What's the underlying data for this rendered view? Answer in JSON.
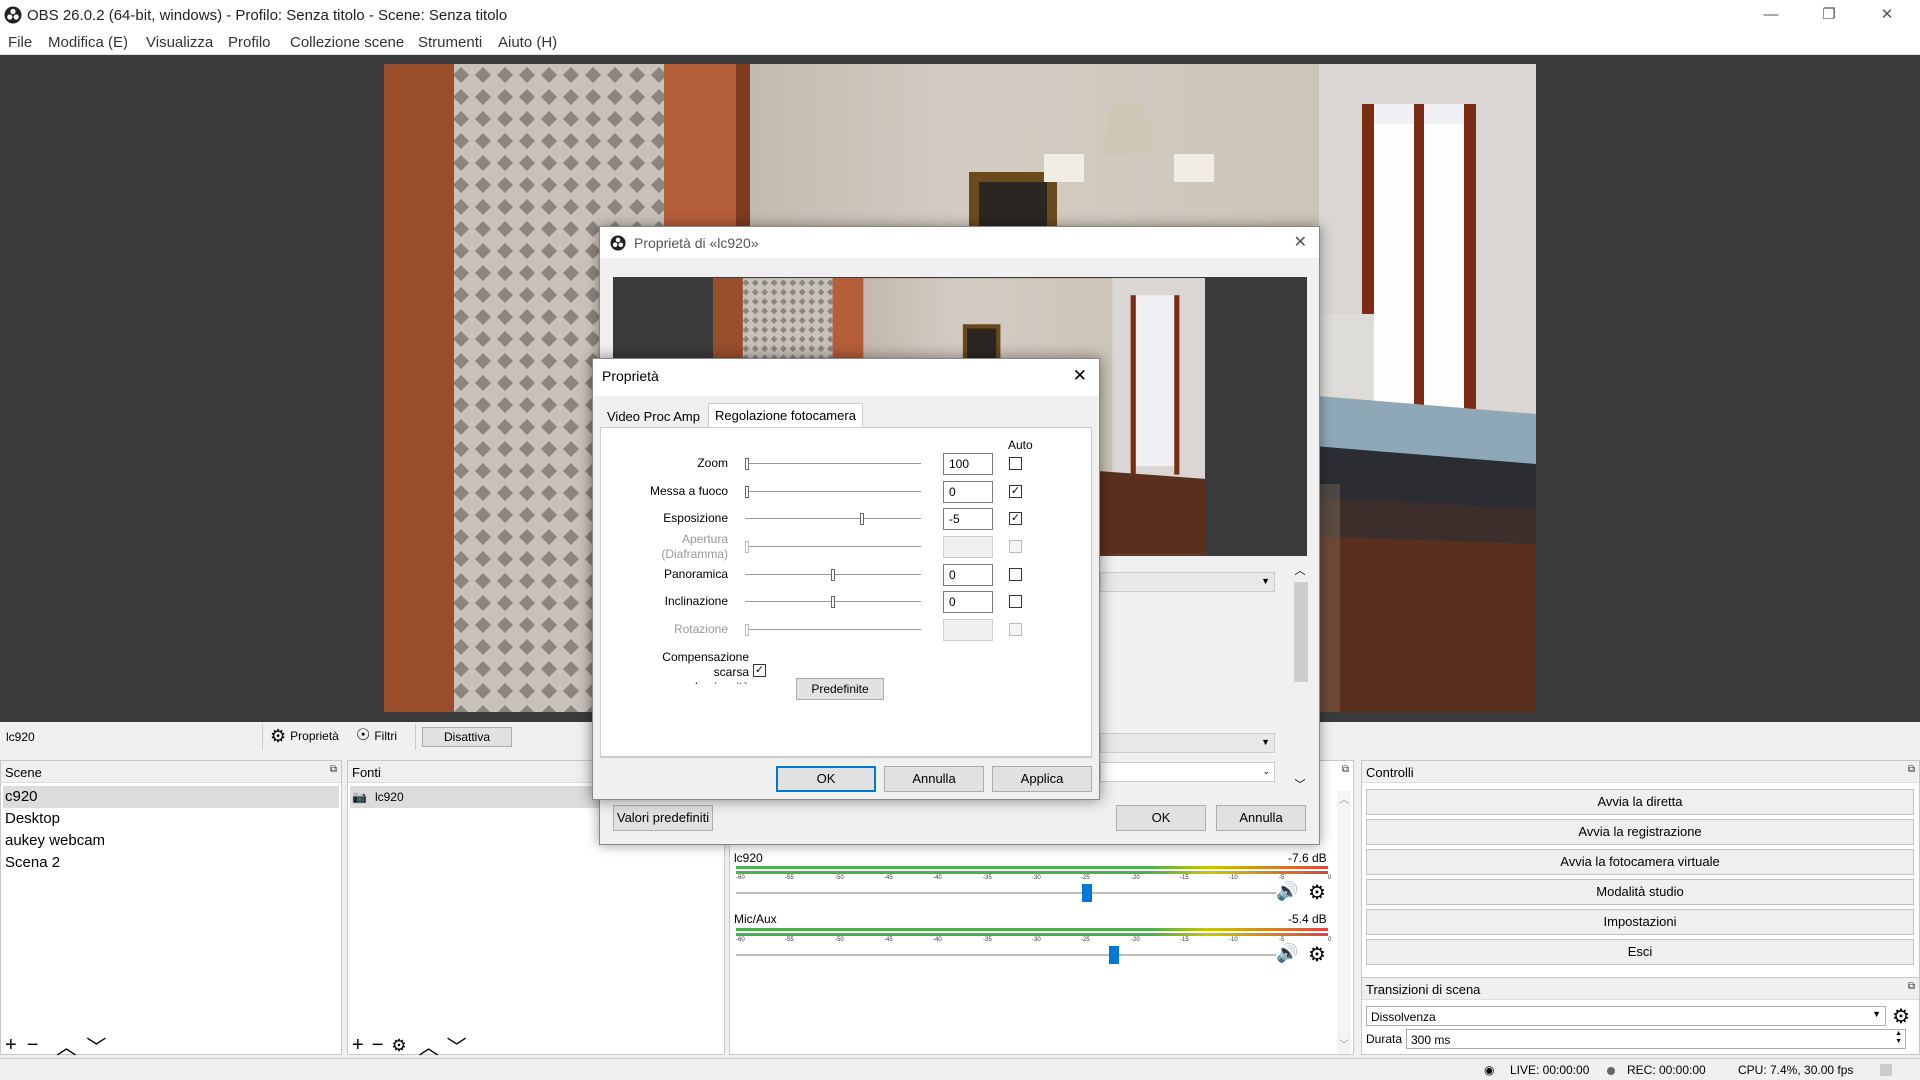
{
  "window": {
    "title": "OBS 26.0.2 (64-bit, windows) - Profilo: Senza titolo - Scene: Senza titolo",
    "minimize": "—",
    "maximize": "❐",
    "close": "✕"
  },
  "menu": [
    "File",
    "Modifica (E)",
    "Visualizza",
    "Profilo",
    "Collezione scene",
    "Strumenti",
    "Aiuto (H)"
  ],
  "source_toolbar": {
    "selected_source": "lc920",
    "properties_label": "Proprietà",
    "filters_label": "Filtri",
    "deactivate_label": "Disattiva"
  },
  "scenes": {
    "header": "Scene",
    "items": [
      "c920",
      "Desktop",
      "aukey webcam",
      "Scena 2"
    ]
  },
  "sources": {
    "header": "Fonti",
    "items": [
      "lc920"
    ]
  },
  "mixer": {
    "channels": [
      {
        "name": "lc920",
        "db": "-7.6 dB",
        "fader": 0.64
      },
      {
        "name": "Mic/Aux",
        "db": "-5.4 dB",
        "fader": 0.69
      }
    ],
    "ticks": [
      "-60",
      "-55",
      "-50",
      "-45",
      "-40",
      "-35",
      "-30",
      "-25",
      "-20",
      "-15",
      "-10",
      "-5",
      "0"
    ]
  },
  "controls": {
    "header": "Controlli",
    "buttons": [
      "Avvia la diretta",
      "Avvia la registrazione",
      "Avvia la fotocamera virtuale",
      "Modalità studio",
      "Impostazioni",
      "Esci"
    ]
  },
  "transitions": {
    "header": "Transizioni di scena",
    "selected": "Dissolvenza",
    "duration_label": "Durata",
    "duration_value": "300 ms"
  },
  "status": {
    "live": "LIVE: 00:00:00",
    "rec": "REC: 00:00:00",
    "cpu": "CPU: 7.4%, 30.00 fps"
  },
  "outer_dialog": {
    "title": "Proprietà di «lc920»",
    "defaults_button": "Valori predefiniti",
    "ok": "OK",
    "cancel": "Annulla"
  },
  "inner_dialog": {
    "title": "Proprietà",
    "tabs": [
      "Video Proc Amp",
      "Regolazione fotocamera"
    ],
    "active_tab": 1,
    "auto_header": "Auto",
    "rows": [
      {
        "label": "Zoom",
        "value": "100",
        "slider": 0.0,
        "auto": false,
        "enabled": true
      },
      {
        "label": "Messa a fuoco",
        "value": "0",
        "slider": 0.0,
        "auto": true,
        "enabled": true
      },
      {
        "label": "Esposizione",
        "value": "-5",
        "slider": 0.67,
        "auto": true,
        "enabled": true
      },
      {
        "label": "Apertura\n(Diaframma)",
        "value": "",
        "slider": 0.0,
        "auto": false,
        "enabled": false
      },
      {
        "label": "Panoramica",
        "value": "0",
        "slider": 0.5,
        "auto": false,
        "enabled": true
      },
      {
        "label": "Inclinazione",
        "value": "0",
        "slider": 0.5,
        "auto": false,
        "enabled": true
      },
      {
        "label": "Rotazione",
        "value": "",
        "slider": 0.0,
        "auto": false,
        "enabled": false
      }
    ],
    "low_light_label": "Compensazione\nscarsa\nluminosità",
    "low_light_checked": true,
    "defaults_button": "Predefinite",
    "ok": "OK",
    "cancel": "Annulla",
    "apply": "Applica"
  }
}
